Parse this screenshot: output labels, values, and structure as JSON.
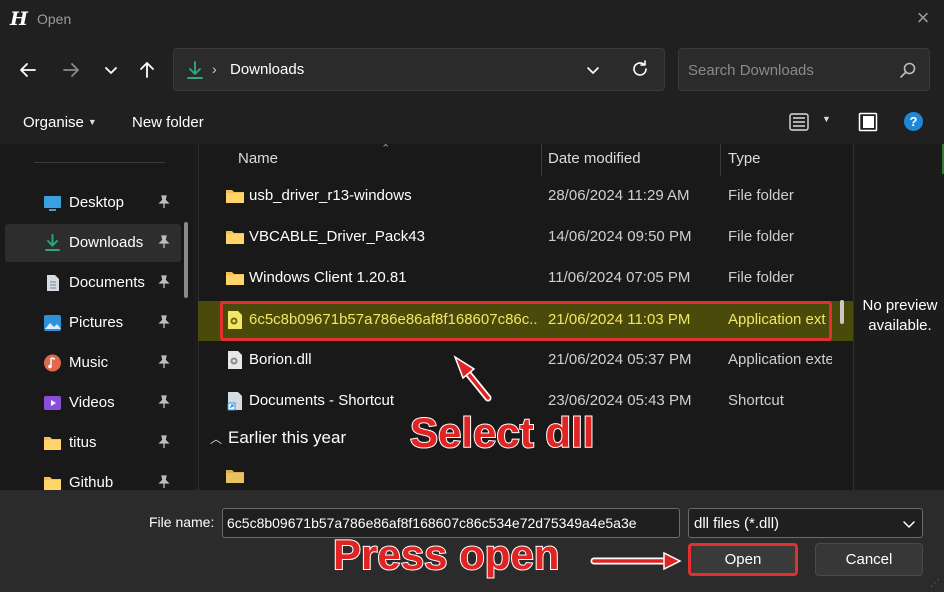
{
  "window": {
    "title": "Open",
    "app_logo_letter": "H"
  },
  "address": {
    "current_folder": "Downloads",
    "separator": "›"
  },
  "search": {
    "placeholder": "Search Downloads"
  },
  "command_bar": {
    "organise": "Organise",
    "new_folder": "New folder",
    "help_glyph": "?"
  },
  "sidebar": {
    "items": [
      {
        "label": "Desktop",
        "icon": "desktop-icon",
        "pinned": true,
        "active": false
      },
      {
        "label": "Downloads",
        "icon": "download-icon",
        "pinned": true,
        "active": true
      },
      {
        "label": "Documents",
        "icon": "documents-icon",
        "pinned": true,
        "active": false
      },
      {
        "label": "Pictures",
        "icon": "pictures-icon",
        "pinned": true,
        "active": false
      },
      {
        "label": "Music",
        "icon": "music-icon",
        "pinned": true,
        "active": false
      },
      {
        "label": "Videos",
        "icon": "videos-icon",
        "pinned": true,
        "active": false
      },
      {
        "label": "titus",
        "icon": "folder-icon",
        "pinned": true,
        "active": false
      },
      {
        "label": "Github",
        "icon": "folder-icon",
        "pinned": true,
        "active": false
      }
    ]
  },
  "file_list": {
    "columns": {
      "name": "Name",
      "date": "Date modified",
      "type": "Type"
    },
    "rows": [
      {
        "name": "usb_driver_r13-windows",
        "date": "28/06/2024 11:29 AM",
        "type": "File folder",
        "icon": "folder-icon",
        "selected": false
      },
      {
        "name": "VBCABLE_Driver_Pack43",
        "date": "14/06/2024 09:50 PM",
        "type": "File folder",
        "icon": "folder-icon",
        "selected": false
      },
      {
        "name": "Windows Client 1.20.81",
        "date": "11/06/2024 07:05 PM",
        "type": "File folder",
        "icon": "folder-icon",
        "selected": false
      },
      {
        "name": "6c5c8b09671b57a786e86af8f168607c86c...",
        "date": "21/06/2024 11:03 PM",
        "type": "Application ext",
        "icon": "dll-file-icon",
        "selected": true
      },
      {
        "name": "Borion.dll",
        "date": "21/06/2024 05:37 PM",
        "type": "Application exte",
        "icon": "dll-file-icon",
        "selected": false
      },
      {
        "name": "Documents - Shortcut",
        "date": "23/06/2024 05:43 PM",
        "type": "Shortcut",
        "icon": "shortcut-icon",
        "selected": false
      }
    ],
    "group_header": "Earlier this year"
  },
  "preview": {
    "text": "No preview available."
  },
  "bottom": {
    "file_name_label": "File name:",
    "file_name_value": "6c5c8b09671b57a786e86af8f168607c86c534e72d75349a4e5a3e",
    "filter": "dll files (*.dll)",
    "open_button": "Open",
    "cancel_button": "Cancel"
  },
  "annotations": {
    "select_dll": "Select dll",
    "press_open": "Press open",
    "color": "#e02424"
  }
}
